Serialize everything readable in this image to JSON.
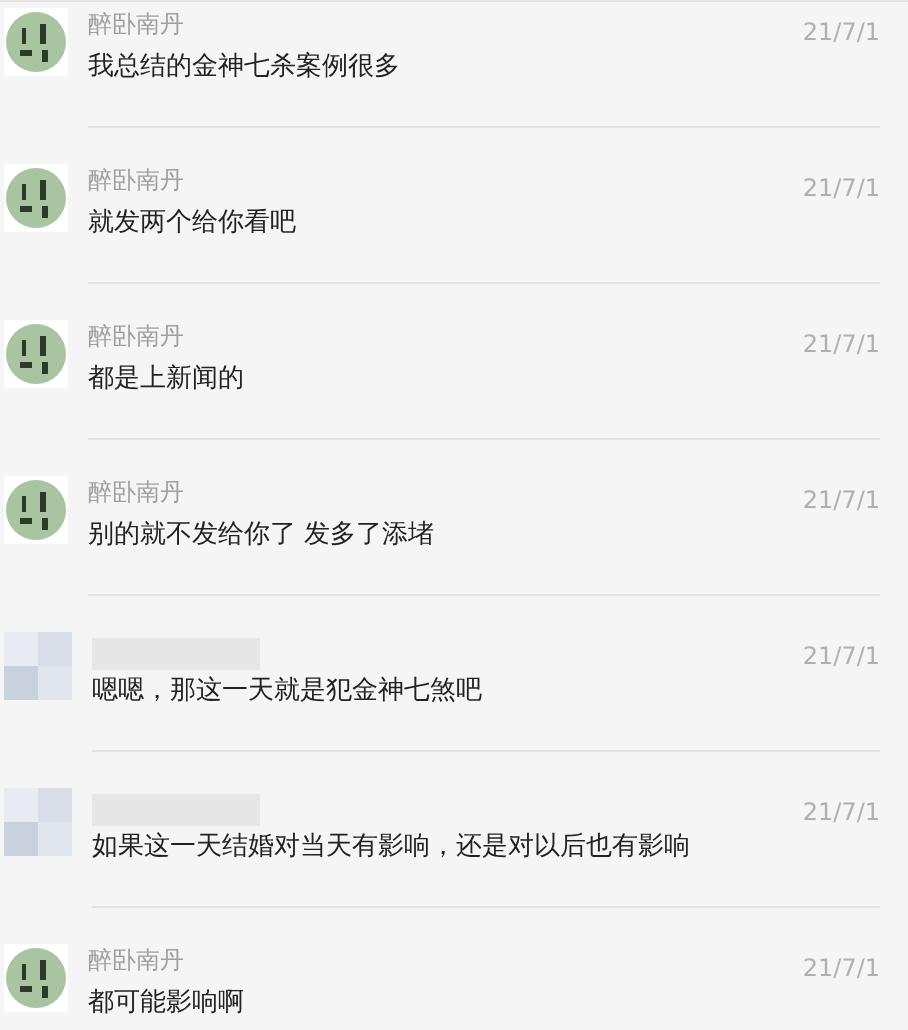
{
  "messages": [
    {
      "sender": "醉卧南丹",
      "kind": "picture",
      "time": "21/7/1",
      "text": "我总结的金神七杀案例很多"
    },
    {
      "sender": "醉卧南丹",
      "kind": "picture",
      "time": "21/7/1",
      "text": "就发两个给你看吧"
    },
    {
      "sender": "醉卧南丹",
      "kind": "picture",
      "time": "21/7/1",
      "text": "都是上新闻的"
    },
    {
      "sender": "醉卧南丹",
      "kind": "picture",
      "time": "21/7/1",
      "text": "别的就不发给你了 发多了添堵"
    },
    {
      "kind": "blurred",
      "time": "21/7/1",
      "text": "嗯嗯，那这一天就是犯金神七煞吧"
    },
    {
      "kind": "blurred",
      "time": "21/7/1",
      "text": "如果这一天结婚对当天有影响，还是对以后也有影响"
    },
    {
      "sender": "醉卧南丹",
      "kind": "picture",
      "time": "21/7/1",
      "text": "都可能影响啊"
    }
  ]
}
